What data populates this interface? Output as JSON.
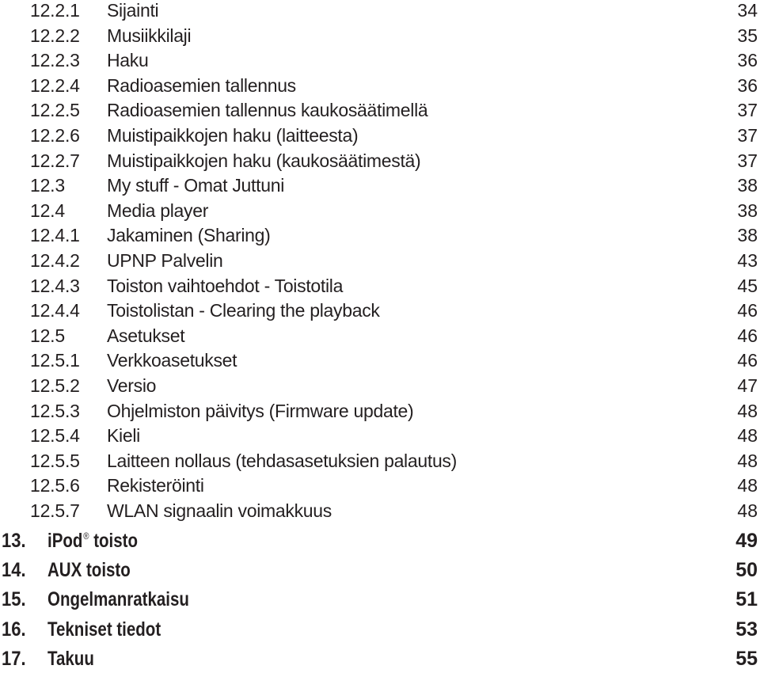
{
  "toc": {
    "sub_entries": [
      {
        "num": "12.2.1",
        "title": "Sijainti",
        "page": "34"
      },
      {
        "num": "12.2.2",
        "title": "Musiikkilaji",
        "page": "35"
      },
      {
        "num": "12.2.3",
        "title": "Haku",
        "page": "36"
      },
      {
        "num": "12.2.4",
        "title": "Radioasemien tallennus",
        "page": "36"
      },
      {
        "num": "12.2.5",
        "title": "Radioasemien tallennus kaukosäätimellä",
        "page": "37"
      },
      {
        "num": "12.2.6",
        "title": "Muistipaikkojen haku (laitteesta)",
        "page": "37"
      },
      {
        "num": "12.2.7",
        "title": "Muistipaikkojen haku (kaukosäätimestä)",
        "page": "37"
      },
      {
        "num": "12.3",
        "title": "My stuff - Omat Juttuni",
        "page": "38"
      },
      {
        "num": "12.4",
        "title": "Media player",
        "page": "38"
      },
      {
        "num": "12.4.1",
        "title": "Jakaminen (Sharing)",
        "page": "38"
      },
      {
        "num": "12.4.2",
        "title": "UPNP Palvelin",
        "page": "43"
      },
      {
        "num": "12.4.3",
        "title": "Toiston vaihtoehdot - Toistotila",
        "page": "45"
      },
      {
        "num": "12.4.4",
        "title": "Toistolistan - Clearing the playback",
        "page": "46"
      },
      {
        "num": "12.5",
        "title": "Asetukset",
        "page": "46"
      },
      {
        "num": "12.5.1",
        "title": "Verkkoasetukset",
        "page": "46"
      },
      {
        "num": "12.5.2",
        "title": "Versio",
        "page": "47"
      },
      {
        "num": "12.5.3",
        "title": "Ohjelmiston päivitys (Firmware update)",
        "page": "48"
      },
      {
        "num": "12.5.4",
        "title": "Kieli",
        "page": "48"
      },
      {
        "num": "12.5.5",
        "title": "Laitteen nollaus (tehdasasetuksien palautus)",
        "page": "48"
      },
      {
        "num": "12.5.6",
        "title": "Rekisteröinti",
        "page": "48"
      },
      {
        "num": "12.5.7",
        "title": "WLAN signaalin voimakkuus",
        "page": "48"
      }
    ],
    "main_entries": [
      {
        "num": "13.",
        "title": "iPod",
        "sup": "®",
        "title_rest": " toisto",
        "page": "49"
      },
      {
        "num": "14.",
        "title": "AUX toisto",
        "sup": "",
        "title_rest": "",
        "page": "50"
      },
      {
        "num": "15.",
        "title": "Ongelmanratkaisu",
        "sup": "",
        "title_rest": "",
        "page": "51"
      },
      {
        "num": "16.",
        "title": "Tekniset tiedot",
        "sup": "",
        "title_rest": "",
        "page": "53"
      },
      {
        "num": "17.",
        "title": "Takuu",
        "sup": "",
        "title_rest": "",
        "page": "55"
      }
    ]
  }
}
